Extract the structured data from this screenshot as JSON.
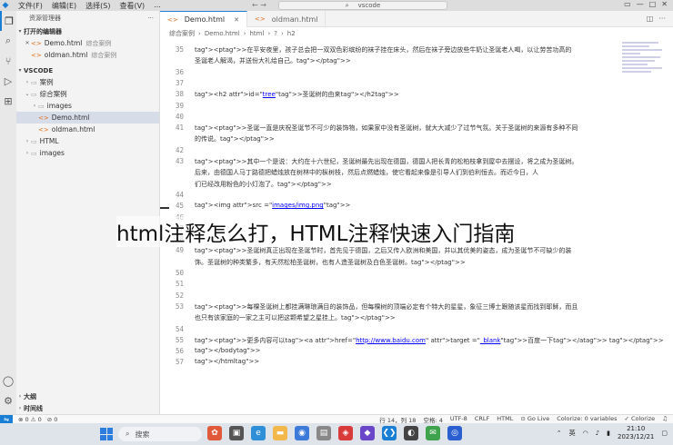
{
  "menu": [
    "文件(F)",
    "编辑(E)",
    "选择(S)",
    "查看(V)",
    "..."
  ],
  "title_search": "vscode",
  "sidebar": {
    "title": "资源管理器",
    "open_editors_header": "打开的编辑器",
    "open_editors": [
      {
        "name": "Demo.html",
        "folder": "综合案例",
        "close": "✕"
      },
      {
        "name": "oldman.html",
        "folder": "综合案例"
      }
    ],
    "workspace_header": "VSCODE",
    "tree": [
      {
        "label": "案例",
        "indent": 1
      },
      {
        "label": "综合案例",
        "indent": 1
      },
      {
        "label": "images",
        "indent": 2
      },
      {
        "label": "Demo.html",
        "indent": 2,
        "selected": true
      },
      {
        "label": "oldman.html",
        "indent": 2
      },
      {
        "label": "HTML",
        "indent": 1
      },
      {
        "label": "images",
        "indent": 1
      }
    ],
    "outline": "大纲",
    "timeline": "时间线"
  },
  "tabs": [
    {
      "label": "Demo.html",
      "active": true
    },
    {
      "label": "oldman.html",
      "active": false
    }
  ],
  "breadcrumb": [
    "综合案例",
    "Demo.html",
    "html",
    "?",
    "h2"
  ],
  "code_lines": [
    {
      "n": "35",
      "text": "<p>在平安夜里，孩子总会把一双双色彩缤纷的袜子挂在床头，然后在袜子旁边放些牛奶让圣诞老人喝，以让劳苦功高的"
    },
    {
      "n": "",
      "text": "圣诞老人解渴，并送份大礼给自己。</p>"
    },
    {
      "n": "36",
      "text": ""
    },
    {
      "n": "37",
      "text": ""
    },
    {
      "n": "38",
      "text": "<h2 id=\"tree\">圣诞树的由来</h2>"
    },
    {
      "n": "39",
      "text": ""
    },
    {
      "n": "40",
      "text": ""
    },
    {
      "n": "41",
      "text": "<p>圣诞一直是庆祝圣诞节不可少的装饰物，如果家中没有圣诞树，就大大减少了过节气氛。关于圣诞树的来源有多种不同"
    },
    {
      "n": "",
      "text": "的传说。</p>"
    },
    {
      "n": "42",
      "text": ""
    },
    {
      "n": "43",
      "text": "<p>其中一个是说：大约在十六世纪，圣诞树最先出现在德国，德国人把长青的松柏枝拿到屋中去摆设，将之成为圣诞树。"
    },
    {
      "n": "",
      "text": "后来，由德国人马丁路德把蜡烛放在树林中的枞树枝，然后点燃蜡烛，使它看起来像是引导人们到伯利恒去。而近今日，人"
    },
    {
      "n": "",
      "text": "们已经改用粉色的小灯泡了。</p>"
    },
    {
      "n": "44",
      "text": ""
    },
    {
      "n": "45",
      "text": "<img src =\"images/img.png\">"
    },
    {
      "n": "46",
      "text": ""
    },
    {
      "n": "47",
      "text": ""
    },
    {
      "n": "48",
      "text": ""
    },
    {
      "n": "49",
      "text": "<p>圣诞树真正出现在圣诞节时，首先见于德国，之后又传入欧洲和美国，并以其优美的姿态，成为圣诞节不可缺少的装"
    },
    {
      "n": "",
      "text": "饰。圣诞树的种类繁多，有天然松柏圣诞树，也有人造圣诞树及白色圣诞树。</p>"
    },
    {
      "n": "50",
      "text": ""
    },
    {
      "n": "51",
      "text": ""
    },
    {
      "n": "52",
      "text": ""
    },
    {
      "n": "53",
      "text": "<p>每棵圣诞树上都挂满琳琅满目的装饰品，但每棵树的顶端必定有个特大的星星，象征三博士跟随该星而找到耶稣，而且"
    },
    {
      "n": "",
      "text": "也只有该家庭的一家之主可以把这颗希望之星挂上。</p>"
    },
    {
      "n": "54",
      "text": ""
    },
    {
      "n": "55",
      "text": "<p>更多内容可以<a href=\"http://www.baidu.com\" target =\"_blank\">百度一下</a>  </p>"
    },
    {
      "n": "56",
      "text": "</body>"
    },
    {
      "n": "57",
      "text": "</html>"
    }
  ],
  "overlay_title": "html注释怎么打，HTML注释快速入门指南",
  "status": {
    "left": [
      "⊗ 0 ⚠ 0",
      "⊘ 0"
    ],
    "right": [
      "行 14，列 18",
      "空格: 4",
      "UTF-8",
      "CRLF",
      "HTML",
      "⊙ Go Live",
      "Colorize: 0 variables",
      "✓ Colorize"
    ]
  },
  "taskbar": {
    "search_placeholder": "搜索",
    "ime": "英",
    "time": "21:10",
    "date": "2023/12/21"
  }
}
